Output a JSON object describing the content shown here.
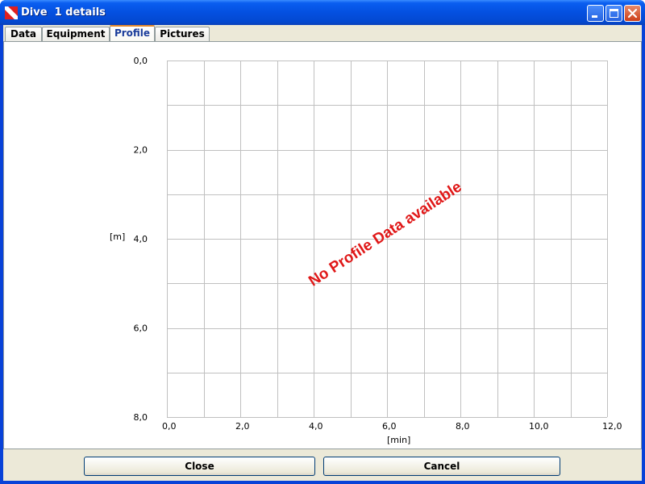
{
  "window": {
    "title": "Dive  1 details",
    "app_icon": "dive-flag-icon",
    "controls": [
      "minimize-icon",
      "maximize-icon",
      "close-icon"
    ]
  },
  "tabs": [
    {
      "label": "Data",
      "active": false
    },
    {
      "label": "Equipment",
      "active": false
    },
    {
      "label": "Profile",
      "active": true
    },
    {
      "label": "Pictures",
      "active": false
    }
  ],
  "profile": {
    "message": "No Profile Data available",
    "message_color": "#e01818"
  },
  "chart_data": {
    "type": "line",
    "series": [],
    "xlabel": "[min]",
    "ylabel": "[m]",
    "xlim": [
      0,
      12
    ],
    "ylim": [
      0,
      8
    ],
    "y_inverted": true,
    "x_ticks": [
      "0,0",
      "2,0",
      "4,0",
      "6,0",
      "8,0",
      "10,0",
      "12,0"
    ],
    "y_ticks": [
      "0,0",
      "2,0",
      "4,0",
      "6,0",
      "8,0"
    ],
    "grid": true,
    "grid_color": "#c0c0c0"
  },
  "buttons": {
    "close_label": "Close",
    "cancel_label": "Cancel"
  }
}
